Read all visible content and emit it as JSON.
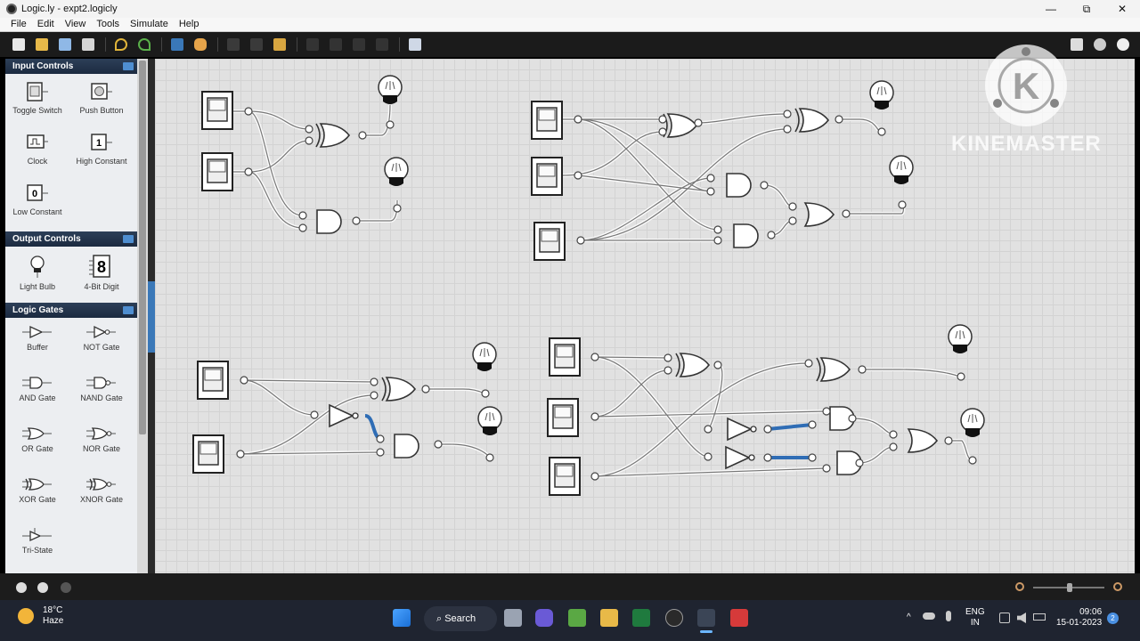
{
  "window": {
    "title": "Logic.ly - expt2.logicly",
    "minimize": "—",
    "maximize": "⧉",
    "close": "✕"
  },
  "menu": [
    "File",
    "Edit",
    "View",
    "Tools",
    "Simulate",
    "Help"
  ],
  "palette": {
    "input_controls": {
      "title": "Input Controls",
      "items": [
        "Toggle Switch",
        "Push Button",
        "Clock",
        "High Constant",
        "Low Constant"
      ],
      "high_glyph": "1",
      "low_glyph": "0"
    },
    "output_controls": {
      "title": "Output Controls",
      "items": [
        "Light Bulb",
        "4-Bit Digit"
      ],
      "digit_glyph": "8"
    },
    "logic_gates": {
      "title": "Logic Gates",
      "items": [
        "Buffer",
        "NOT Gate",
        "AND Gate",
        "NAND Gate",
        "OR Gate",
        "NOR Gate",
        "XOR Gate",
        "XNOR Gate",
        "Tri-State"
      ]
    }
  },
  "taskbar": {
    "temperature": "18°C",
    "weather": "Haze",
    "search": "Search",
    "language": "ENG",
    "region": "IN",
    "time": "09:06",
    "date": "15-01-2023",
    "notifications": "2"
  },
  "watermark": {
    "text": "KINEMASTER",
    "logo_letter": "K"
  },
  "colors": {
    "accent": "#3a78b8",
    "highlight_wire": "#2f6db5",
    "canvas": "#e1e1e1"
  }
}
